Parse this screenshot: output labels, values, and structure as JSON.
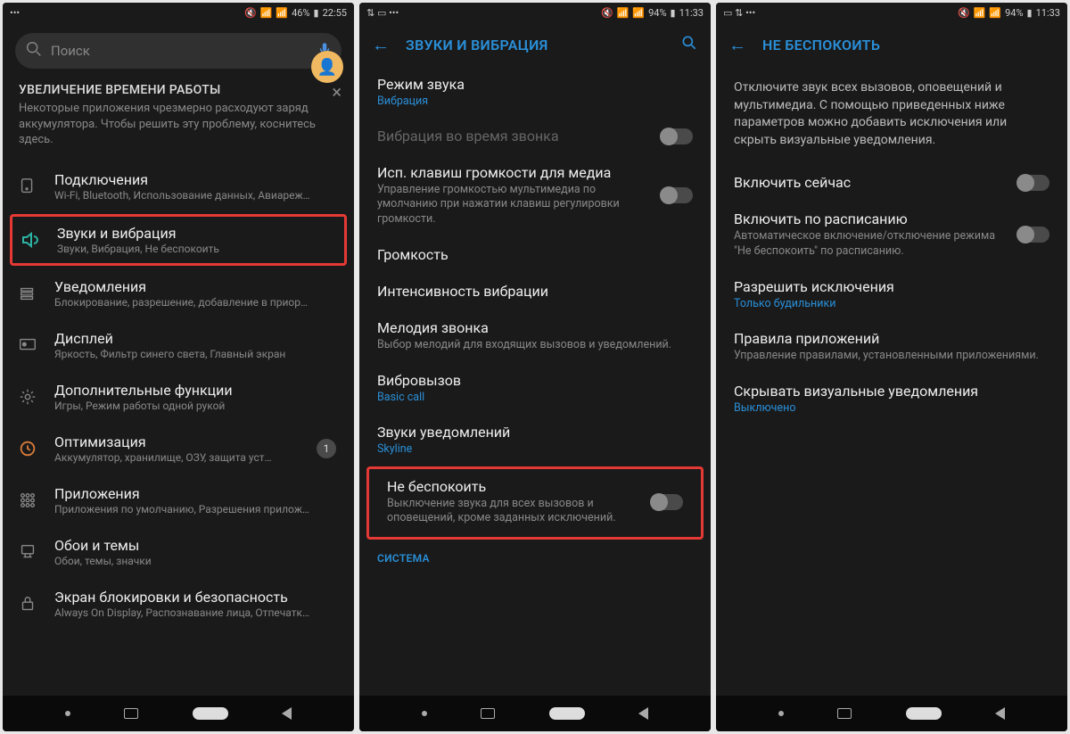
{
  "screen1": {
    "status": {
      "battery": "46%",
      "time": "22:55"
    },
    "search_placeholder": "Поиск",
    "banner": {
      "title": "УВЕЛИЧЕНИЕ ВРЕМЕНИ РАБОТЫ",
      "text": "Некоторые приложения чрезмерно расходуют заряд аккумулятора. Чтобы решить эту проблему, коснитесь здесь."
    },
    "items": [
      {
        "title": "Подключения",
        "sub": "Wi-Fi, Bluetooth, Использование данных, Авиареж…",
        "icon": "connections"
      },
      {
        "title": "Звуки и вибрация",
        "sub": "Звуки, Вибрация, Не беспокоить",
        "icon": "sound",
        "highlight": true
      },
      {
        "title": "Уведомления",
        "sub": "Блокирование, разрешение, добавление в приор…",
        "icon": "notifications"
      },
      {
        "title": "Дисплей",
        "sub": "Яркость, Фильтр синего света, Главный экран",
        "icon": "display"
      },
      {
        "title": "Дополнительные функции",
        "sub": "Игры, Режим работы одной рукой",
        "icon": "advanced"
      },
      {
        "title": "Оптимизация",
        "sub": "Аккумулятор, хранилище, ОЗУ, защита уст…",
        "icon": "optimize",
        "badge": "1"
      },
      {
        "title": "Приложения",
        "sub": "Приложения по умолчанию, Разрешения прилож…",
        "icon": "apps"
      },
      {
        "title": "Обои и темы",
        "sub": "Обои, темы, значки",
        "icon": "wallpaper"
      },
      {
        "title": "Экран блокировки и безопасность",
        "sub": "Always On Display, Распознавание лица, Отпечатк…",
        "icon": "lock"
      }
    ]
  },
  "screen2": {
    "status": {
      "battery": "94%",
      "time": "11:33"
    },
    "header_title": "ЗВУКИ И ВИБРАЦИЯ",
    "prefs": {
      "sound_mode": {
        "title": "Режим звука",
        "value": "Вибрация"
      },
      "vibrate_ring": {
        "title": "Вибрация во время звонка"
      },
      "volume_keys": {
        "title": "Исп. клавиш громкости для медиа",
        "sub": "Управление громкостью мультимедиа по умолчанию при нажатии клавиш регулировки громкости."
      },
      "volume": {
        "title": "Громкость"
      },
      "vib_intensity": {
        "title": "Интенсивность вибрации"
      },
      "ringtone": {
        "title": "Мелодия звонка",
        "sub": "Выбор мелодий для входящих вызовов и уведомлений."
      },
      "vib_pattern": {
        "title": "Вибровызов",
        "value": "Basic call"
      },
      "notif_sound": {
        "title": "Звуки уведомлений",
        "value": "Skyline"
      },
      "dnd": {
        "title": "Не беспокоить",
        "sub": "Выключение звука для всех вызовов и оповещений, кроме заданных исключений."
      },
      "system_section": "СИСТЕМА"
    }
  },
  "screen3": {
    "status": {
      "battery": "94%",
      "time": "11:33"
    },
    "header_title": "НЕ БЕСПОКОИТЬ",
    "description": "Отключите звук всех вызовов, оповещений и мультимедиа. С помощью приведенных ниже параметров можно добавить исключения или скрыть визуальные уведомления.",
    "prefs": {
      "enable_now": {
        "title": "Включить сейчас"
      },
      "schedule": {
        "title": "Включить по расписанию",
        "sub": "Автоматическое включение/отключение режима \"Не беспокоить\" по расписанию."
      },
      "exceptions": {
        "title": "Разрешить исключения",
        "value": "Только будильники"
      },
      "app_rules": {
        "title": "Правила приложений",
        "sub": "Управление правилами, установленными приложениями."
      },
      "hide_visual": {
        "title": "Скрывать визуальные уведомления",
        "value": "Выключено"
      }
    }
  }
}
